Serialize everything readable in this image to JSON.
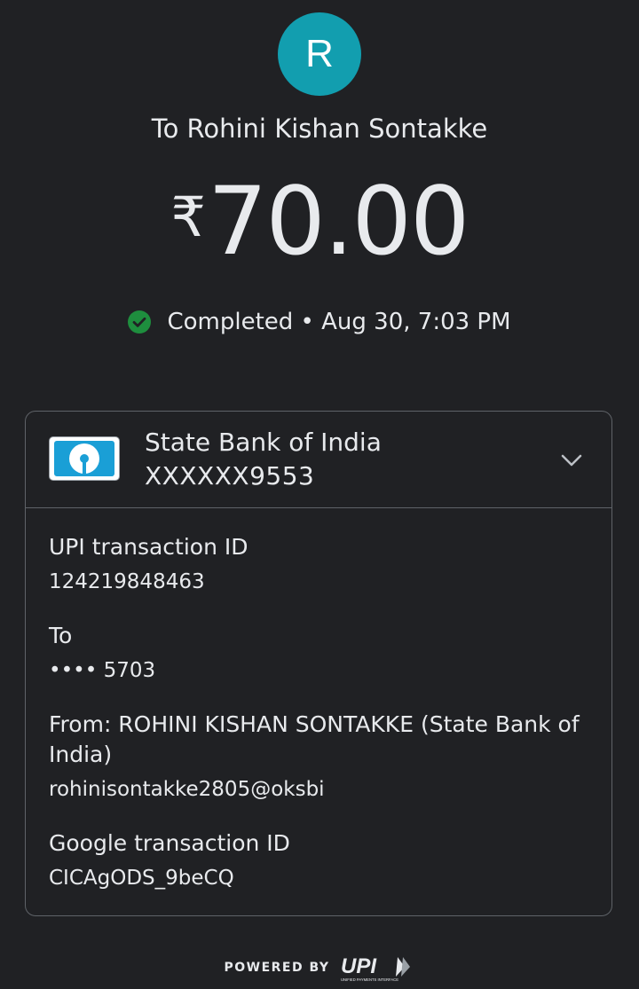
{
  "avatar": {
    "initial": "R",
    "color": "#129eaf"
  },
  "recipient": {
    "label": "To Rohini Kishan Sontakke"
  },
  "amount": {
    "currency": "₹",
    "value": "70.00"
  },
  "status": {
    "icon": "check-circle-icon",
    "text": "Completed • Aug 30, 7:03 PM",
    "color": "#1e8e3e"
  },
  "bank": {
    "name": "State Bank of India",
    "account": "XXXXXX9553",
    "logo": "sbi-logo",
    "expand_icon": "chevron-down-icon"
  },
  "details": [
    {
      "label": "UPI transaction ID",
      "value": "124219848463"
    },
    {
      "label": "To",
      "value": "•••• 5703"
    },
    {
      "label": "From: ROHINI KISHAN SONTAKKE (State Bank of India)",
      "value": "rohinisontakke2805@oksbi"
    },
    {
      "label": "Google transaction ID",
      "value": "CICAgODS_9beCQ"
    }
  ],
  "footer": {
    "powered_by": "POWERED BY",
    "logo_text": "UPI",
    "logo_subtext": "UNIFIED PAYMENTS INTERFACE"
  }
}
